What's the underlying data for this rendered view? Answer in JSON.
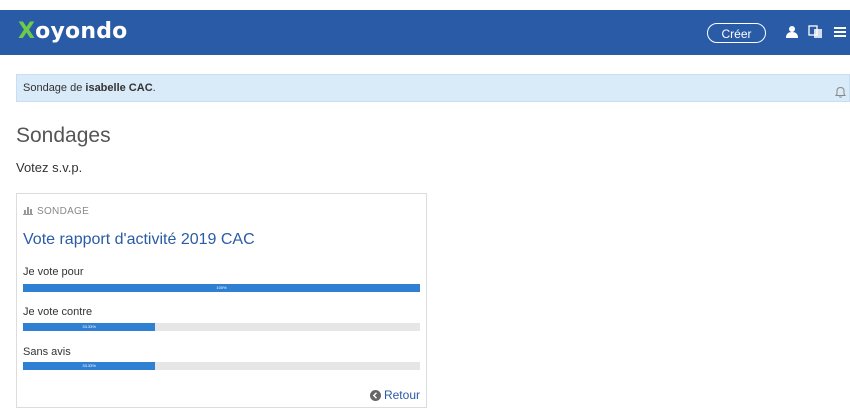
{
  "header": {
    "logo_first": "X",
    "logo_rest": "oyondo",
    "create_label": "Créer"
  },
  "notice": {
    "prefix": "Sondage de ",
    "author": "isabelle CAC",
    "suffix": "."
  },
  "page": {
    "title": "Sondages",
    "subtitle": "Votez s.v.p."
  },
  "poll": {
    "kind_label": "SONDAGE",
    "title": "Vote rapport d'activité 2019 CAC",
    "options": [
      {
        "label": "Je vote pour",
        "percent_text": "100%",
        "fraction": 1.0
      },
      {
        "label": "Je vote contre",
        "percent_text": "33.33%",
        "fraction": 0.3333
      },
      {
        "label": "Sans avis",
        "percent_text": "33.33%",
        "fraction": 0.3333
      }
    ],
    "back_label": "Retour"
  },
  "colors": {
    "header_bg": "#2a5ba7",
    "logo_accent": "#6ccb4b",
    "bar_fill": "#2f7fd3",
    "notice_bg": "#d9eaf8"
  }
}
